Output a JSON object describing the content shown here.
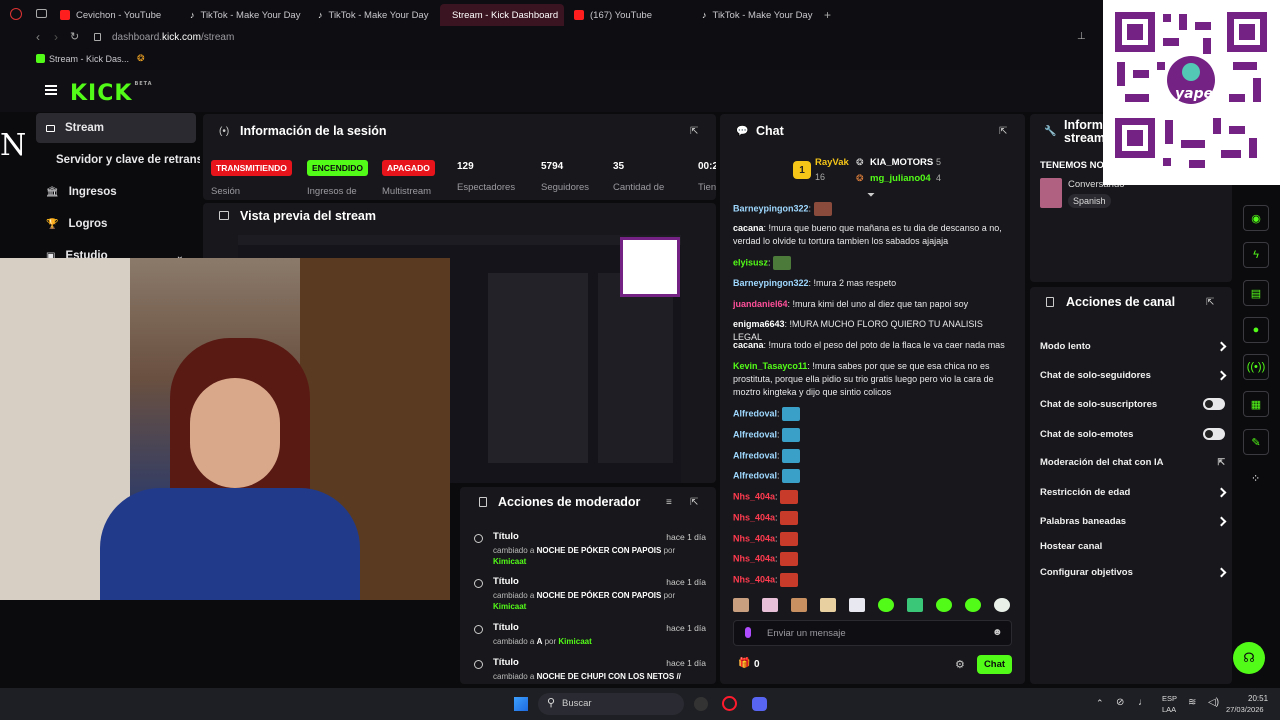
{
  "browser": {
    "tabs": [
      {
        "label": "Cevichon - YouTube",
        "icon": "youtube-icon"
      },
      {
        "label": "TikTok - Make Your Day",
        "icon": "tiktok-icon"
      },
      {
        "label": "TikTok - Make Your Day",
        "icon": "tiktok-icon"
      },
      {
        "label": "Stream - Kick Dashboard",
        "icon": "kick-icon",
        "active": true
      },
      {
        "label": "(167) YouTube",
        "icon": "youtube-icon"
      },
      {
        "label": "TikTok - Make Your Day",
        "icon": "tiktok-icon"
      }
    ],
    "new_tab": "+",
    "url_host": "dashboard.",
    "url_domain": "kick.com",
    "url_path": "/stream",
    "bookmark": "Stream - Kick Das..."
  },
  "app": {
    "logo": "KICK",
    "logo_beta": "BETA",
    "accent": "#53fc18"
  },
  "sidebar": {
    "items": [
      {
        "label": "Stream",
        "icon": "stream-icon",
        "active": true
      },
      {
        "label": "Servidor y clave de retransm",
        "icon": ""
      },
      {
        "label": "Ingresos",
        "icon": "bank-icon"
      },
      {
        "label": "Logros",
        "icon": "trophy-icon"
      },
      {
        "label": "Estudio",
        "icon": "studio-icon"
      }
    ]
  },
  "session": {
    "title": "Información de la sesión",
    "badges": [
      "TRANSMITIENDO",
      "ENCENDIDO",
      "APAGADO"
    ],
    "badge_labels": [
      "Sesión",
      "Ingresos de",
      "Multistream"
    ],
    "stats": [
      {
        "value": "129",
        "label": "Espectadores"
      },
      {
        "value": "5794",
        "label": "Seguidores"
      },
      {
        "value": "35",
        "label": "Cantidad de"
      },
      {
        "value": "00:2",
        "label": "Tien"
      }
    ]
  },
  "preview": {
    "title": "Vista previa del stream"
  },
  "moderator": {
    "title": "Acciones de moderador",
    "rows": [
      {
        "field": "Título",
        "time": "hace 1 día",
        "changed": "cambiado a",
        "value": "NOCHE DE PÓKER CON PAPOIS",
        "by": "por",
        "user": "Kimicaat"
      },
      {
        "field": "Título",
        "time": "hace 1 día",
        "changed": "cambiado a",
        "value": "NOCHE DE PÓKER CON PAPOIS",
        "by": "por",
        "user": "Kimicaat"
      },
      {
        "field": "Título",
        "time": "hace 1 día",
        "changed": "cambiado a",
        "value": "A",
        "by": "por",
        "user": "Kimicaat"
      },
      {
        "field": "Título",
        "time": "hace 1 día",
        "changed": "cambiado a",
        "value": "NOCHE DE CHUPI CON LOS NETOS //",
        "by": "",
        "user": ""
      }
    ]
  },
  "chat": {
    "title": "Chat",
    "top": [
      {
        "name": "RayVak",
        "count": "16"
      },
      {
        "name": "KIA_MOTORS",
        "count": "5"
      },
      {
        "name": "mg_juliano04",
        "count": "4"
      }
    ],
    "messages": [
      {
        "user": "Barneypingon322",
        "color": "#9fd8ff",
        "text": "",
        "emote": "#8a4b3c"
      },
      {
        "user": "cacana",
        "color": "#ffffff",
        "text": "!mura que bueno que mañana es tu dia de descanso a no, verdad lo olvide tu tortura tambien los sabados ajajaja"
      },
      {
        "user": "elyisusz",
        "color": "#53fc18",
        "text": "",
        "emote": "#4b7a3a"
      },
      {
        "user": "Barneypingon322",
        "color": "#9fd8ff",
        "text": "!mura 2 mas respeto"
      },
      {
        "user": "juandaniel64",
        "color": "#ff4f9a",
        "text": "!mura kimi del uno al diez que tan papoi soy"
      },
      {
        "user": "enigma6643",
        "color": "#ffffff",
        "text": "!MURA MUCHO FLORO QUIERO TU ANALISIS LEGAL"
      },
      {
        "user": "cacana",
        "color": "#ffffff",
        "text": "!mura todo el peso del poto de la flaca le va caer nada mas"
      },
      {
        "user": "Kevin_Tasayco11",
        "color": "#53fc18",
        "text": "!mura sabes por que se que esa chica no es prostituta, porque ella pidio su trio gratis luego pero vio la cara de moztro kingteka y dijo que sintio colicos"
      },
      {
        "user": "Alfredoval",
        "color": "#9fd8ff",
        "text": "",
        "emote": "#3aa0c8"
      },
      {
        "user": "Alfredoval",
        "color": "#9fd8ff",
        "text": "",
        "emote": "#3aa0c8"
      },
      {
        "user": "Alfredoval",
        "color": "#9fd8ff",
        "text": "",
        "emote": "#3aa0c8"
      },
      {
        "user": "Alfredoval",
        "color": "#9fd8ff",
        "text": "",
        "emote": "#3aa0c8"
      },
      {
        "user": "Nhs_404a",
        "color": "#ff3b4f",
        "text": "",
        "emote": "#c83a2a"
      },
      {
        "user": "Nhs_404a",
        "color": "#ff3b4f",
        "text": "",
        "emote": "#c83a2a"
      },
      {
        "user": "Nhs_404a",
        "color": "#ff3b4f",
        "text": "",
        "emote": "#c83a2a"
      },
      {
        "user": "Nhs_404a",
        "color": "#ff3b4f",
        "text": "",
        "emote": "#c83a2a"
      },
      {
        "user": "Nhs_404a",
        "color": "#ff3b4f",
        "text": "",
        "emote": "#c83a2a"
      }
    ],
    "input_placeholder": "Enviar un mensaje",
    "points": "0",
    "send_label": "Chat"
  },
  "right_panel": {
    "title_1": "Inform",
    "title_2": "stream",
    "tenemos": "TENEMOS NO",
    "category": "Conversando",
    "language": "Spanish"
  },
  "canal": {
    "title": "Acciones de canal",
    "rows": [
      {
        "label": "Modo lento",
        "control": "chevron"
      },
      {
        "label": "Chat de solo-seguidores",
        "control": "chevron"
      },
      {
        "label": "Chat de solo-suscriptores",
        "control": "toggle"
      },
      {
        "label": "Chat de solo-emotes",
        "control": "toggle"
      },
      {
        "label": "Moderación del chat con IA",
        "control": "external"
      },
      {
        "label": "Restricción de edad",
        "control": "chevron"
      },
      {
        "label": "Palabras baneadas",
        "control": "chevron"
      },
      {
        "label": "Hostear canal",
        "control": "none"
      },
      {
        "label": "Configurar objetivos",
        "control": "chevron"
      }
    ]
  },
  "overlay": {
    "qr_brand": "yape",
    "qr_color": "#742284"
  },
  "taskbar": {
    "search": "Buscar",
    "lang_1": "ESP",
    "lang_2": "LAA",
    "time": "20:51",
    "date": "27/03/2026"
  }
}
